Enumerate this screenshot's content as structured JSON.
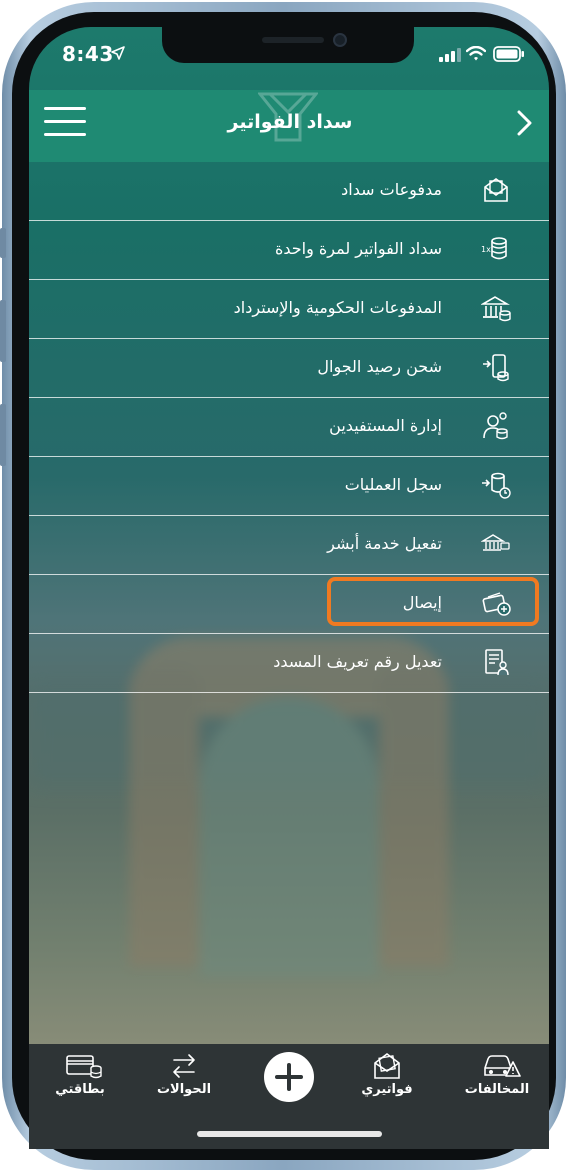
{
  "status_bar": {
    "time": "8:43"
  },
  "header": {
    "title": "سداد الفواتير"
  },
  "menu": {
    "items": [
      {
        "label": "مدفوعات سداد",
        "icon": "bill-envelope-icon"
      },
      {
        "label": "سداد الفواتير لمرة واحدة",
        "icon": "one-time-coins-icon"
      },
      {
        "label": "المدفوعات الحكومية والإسترداد",
        "icon": "government-bank-icon"
      },
      {
        "label": "شحن رصيد الجوال",
        "icon": "mobile-recharge-icon"
      },
      {
        "label": "إدارة المستفيدين",
        "icon": "beneficiaries-icon"
      },
      {
        "label": "سجل العمليات",
        "icon": "transactions-history-icon"
      },
      {
        "label": "تفعيل خدمة أبشر",
        "icon": "absher-activation-icon"
      },
      {
        "label": "إيصال",
        "icon": "receipt-icon"
      },
      {
        "label": "تعديل رقم تعريف المسدد",
        "icon": "payer-id-icon"
      }
    ],
    "highlighted_index": 7,
    "highlight_color": "#f07a21"
  },
  "tabbar": {
    "tabs": [
      {
        "label": "المخالفات",
        "icon": "car-warning-icon"
      },
      {
        "label": "فواتيري",
        "icon": "my-bills-icon"
      },
      {
        "label": "الحوالات",
        "icon": "transfers-arrows-icon"
      },
      {
        "label": "بطاقتي",
        "icon": "my-card-icon"
      }
    ],
    "center_icon": "plus-icon"
  },
  "colors": {
    "header": "#1f8a73",
    "tabbar": "#2e3436"
  }
}
